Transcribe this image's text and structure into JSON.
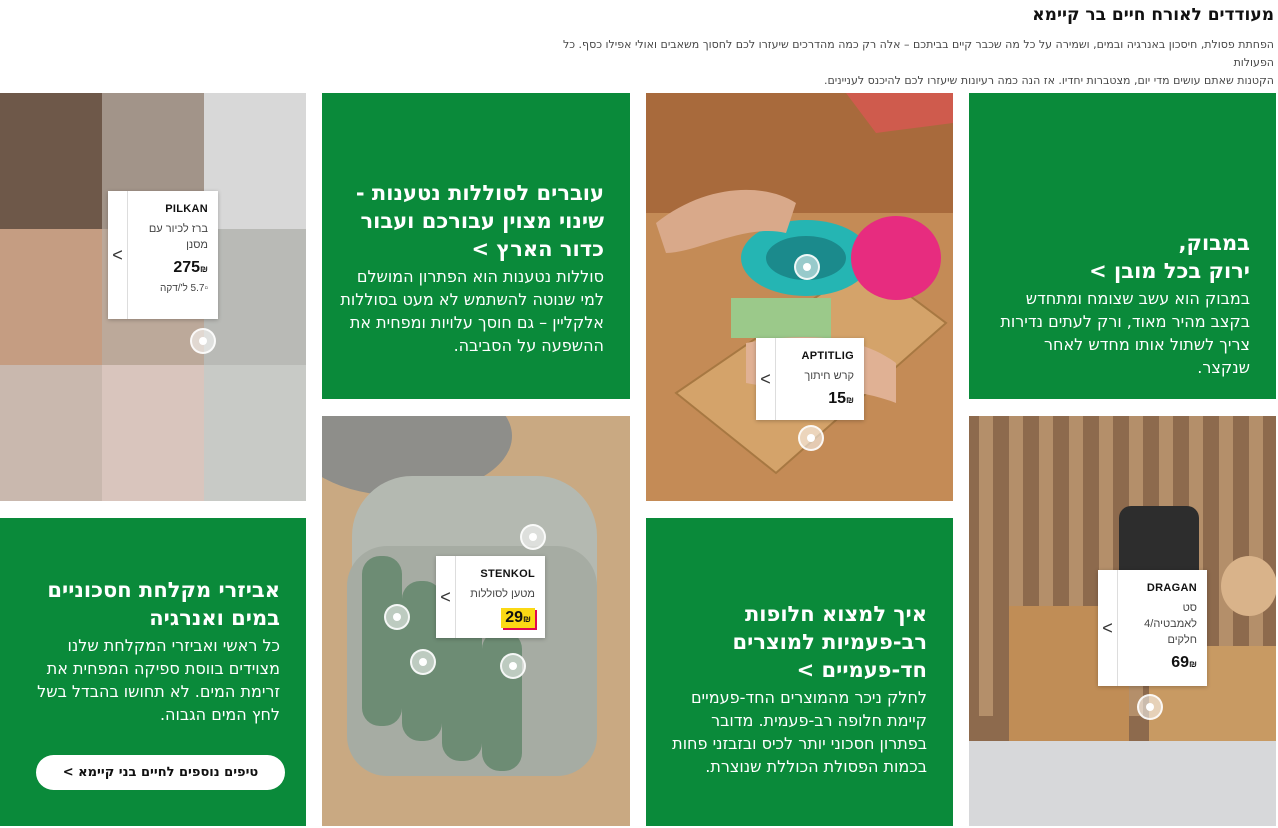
{
  "page": {
    "title": "מעודדים לאורח חיים בר קיימא",
    "subtitle_line1": "הפחתת פסולת, חיסכון באנרגיה ובמים, ושמירה על כל מה שכבר קיים בביתכם – אלה רק כמה מהדרכים שיעזרו לכם לחסוך משאבים ואולי אפילו כסף. כל הפעולות",
    "subtitle_line2": "הקטנות שאתם עושים מדי יום, מצטברות יחדיו. אז הנה כמה רעיונות שיעזרו לכם להיכנס לעניינים."
  },
  "colors": {
    "green": "#0a8a3a",
    "price_highlight": "#fbd914",
    "price_shadow": "#e00751"
  },
  "tiles": {
    "bamboo": {
      "heading_line1": "במבוק,",
      "heading_line2": "ירוק בכל מובן >",
      "body": "במבוק הוא עשב שצומח ומתחדש בקצב מהיר מאוד, ורק לעתים נדירות צריך לשתול אותו מחדש לאחר שנקצר."
    },
    "batteries": {
      "heading": "עוברים לסוללות נטענות - שינוי מצוין עבורכם ועבור כדור הארץ >",
      "body": "סוללות נטענות הוא הפתרון המושלם למי שנוטה להשתמש לא מעט בסוללות אלקליין – גם חוסך עלויות ומפחית את ההשפעה על הסביבה."
    },
    "reusable": {
      "heading": "איך למצוא חלופות רב-פעמיות למוצרים חד-פעמיים >",
      "body": "לחלק ניכר מהמוצרים החד-פעמיים קיימת חלופה רב-פעמית. מדובר בפתרון חסכוני יותר לכיס ובזבזני פחות בכמות הפסולת הכוללת שנוצרת."
    },
    "kitchen": {
      "heading": "אביזרי מקלחת חסכוניים במים ואנרגיה",
      "body": "כל ראשי ואביזרי המקלחת שלנו מצוידים בווסת ספיקה המפחית את זרימת המים. לא תחושו בהבדל בשל לחץ המים הגבוה.",
      "cta": "טיפים נוספים לחיים בני קיימא >"
    }
  },
  "products": {
    "pilkan": {
      "name": "PILKAN",
      "desc": "ברז לכיור עם מסנן",
      "price": "275",
      "currency": "₪",
      "unit": "5.7 ל'/דקה",
      "chevron": "<"
    },
    "aptitlig": {
      "name": "APTITLIG",
      "desc": "קרש חיתוך",
      "price": "15",
      "currency": "₪",
      "chevron": "<"
    },
    "stenkol": {
      "name": "STENKOL",
      "desc": "מטען לסוללות",
      "price": "29",
      "currency": "₪",
      "chevron": "<"
    },
    "dragan": {
      "name": "DRAGAN",
      "desc": "סט לאמבטיה/4 חלקים",
      "price": "69",
      "currency": "₪",
      "chevron": "<"
    }
  },
  "icons": [
    "chevron-left-icon",
    "hotspot-dot-icon",
    "broken-image-icon"
  ]
}
